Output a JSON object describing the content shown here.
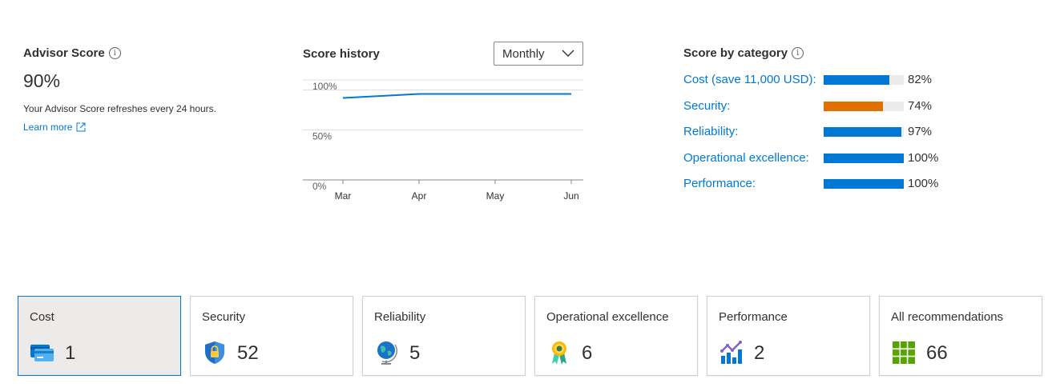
{
  "advisor_score": {
    "title": "Advisor Score",
    "value": "90%",
    "refresh_text": "Your Advisor Score refreshes every 24 hours.",
    "learn_more": "Learn more"
  },
  "score_history": {
    "title": "Score history",
    "period": "Monthly"
  },
  "score_by_category": {
    "title": "Score by category",
    "items": [
      {
        "label": "Cost (save 11,000 USD):",
        "percent": 82,
        "percent_text": "82%",
        "color": "#0078d4"
      },
      {
        "label": "Security:",
        "percent": 74,
        "percent_text": "74%",
        "color": "#e07000"
      },
      {
        "label": "Reliability:",
        "percent": 97,
        "percent_text": "97%",
        "color": "#0078d4"
      },
      {
        "label": "Operational excellence:",
        "percent": 100,
        "percent_text": "100%",
        "color": "#0078d4"
      },
      {
        "label": "Performance:",
        "percent": 100,
        "percent_text": "100%",
        "color": "#0078d4"
      }
    ]
  },
  "tiles": [
    {
      "label": "Cost",
      "count": "1",
      "icon": "credit-card-icon",
      "selected": true
    },
    {
      "label": "Security",
      "count": "52",
      "icon": "shield-lock-icon",
      "selected": false
    },
    {
      "label": "Reliability",
      "count": "5",
      "icon": "globe-icon",
      "selected": false
    },
    {
      "label": "Operational excellence",
      "count": "6",
      "icon": "award-ribbon-icon",
      "selected": false
    },
    {
      "label": "Performance",
      "count": "2",
      "icon": "bar-chart-trend-icon",
      "selected": false
    },
    {
      "label": "All recommendations",
      "count": "66",
      "icon": "grid-icon",
      "selected": false
    }
  ],
  "chart_data": {
    "type": "line",
    "title": "Score history",
    "x": [
      "Mar",
      "Apr",
      "May",
      "Jun"
    ],
    "series": [
      {
        "values": [
          82,
          86,
          86,
          86
        ]
      }
    ],
    "y_ticks": [
      "0%",
      "50%",
      "100%"
    ],
    "ylim": [
      0,
      100
    ],
    "color": "#0078d4",
    "grid": true
  }
}
